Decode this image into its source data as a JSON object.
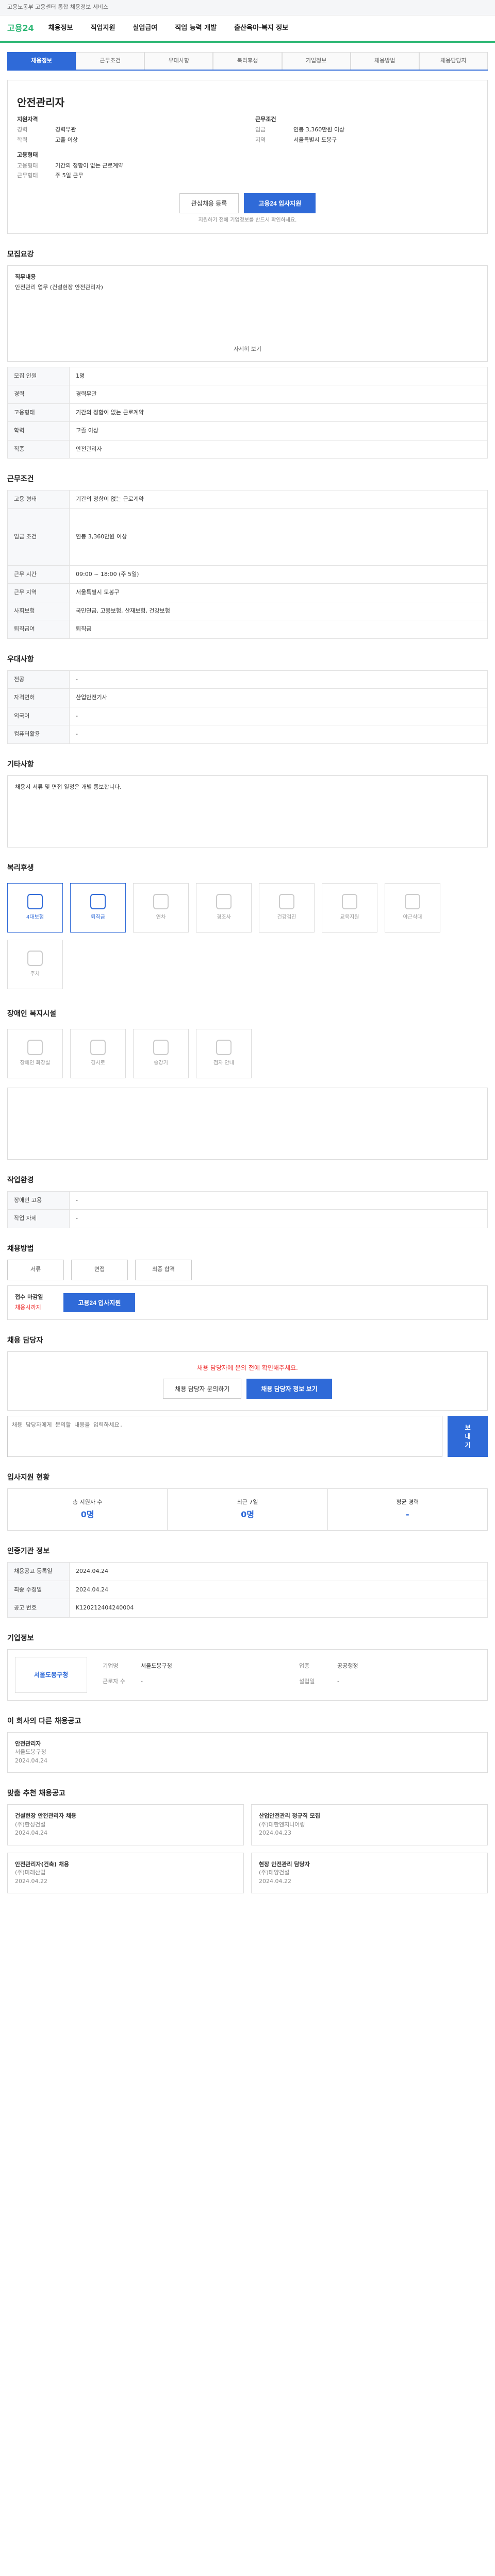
{
  "topbar": {
    "text": "고용노동부 고용센터 통합 채용정보 서비스"
  },
  "gnb": {
    "logo": "고용24",
    "menu": [
      "채용정보",
      "직업지원",
      "실업급여",
      "직업 능력 개발",
      "출산육아·복지 정보"
    ]
  },
  "tabs": [
    "채용정보",
    "근무조건",
    "우대사항",
    "복리후생",
    "기업정보",
    "채용방법",
    "채용담당자"
  ],
  "header": {
    "company": "안전관리자",
    "tag": "채용공고"
  },
  "company_info": {
    "left_title": "지원자격",
    "left_items": [
      {
        "k": "경력",
        "v": "경력무관"
      },
      {
        "k": "학력",
        "v": "고졸 이상"
      }
    ],
    "right_title": "근무조건",
    "right_items": [
      {
        "k": "임금",
        "v": "연봉 3,360만원 이상"
      },
      {
        "k": "지역",
        "v": "서울특별시 도봉구"
      }
    ],
    "job_title": "고용형태",
    "job_items": [
      {
        "k": "고용형태",
        "v": "기간의 정함이 없는 근로계약"
      },
      {
        "k": "근무형태",
        "v": "주 5일 근무"
      }
    ],
    "cta_primary": "고용24 입사지원",
    "cta_secondary": "관심채용 등록",
    "notice": "지원하기 전에 기업정보를 반드시 확인하세요."
  },
  "job": {
    "title": "모집요강",
    "duty_label": "직무내용",
    "duty": "안전관리 업무 (건설현장 안전관리자)",
    "list_label": "자세히 보기"
  },
  "job_table": [
    {
      "k": "모집 인원",
      "v": "1명"
    },
    {
      "k": "경력",
      "v": "경력무관"
    },
    {
      "k": "고용형태",
      "v": "기간의 정함이 없는 근로계약"
    },
    {
      "k": "학력",
      "v": "고졸 이상"
    },
    {
      "k": "직종",
      "v": "안전관리자"
    }
  ],
  "work": {
    "title": "근무조건"
  },
  "work_table": [
    {
      "k": "고용 형태",
      "v": "기간의 정함이 없는 근로계약"
    },
    {
      "k": "임금 조건",
      "v": "연봉 3,360만원 이상"
    },
    {
      "k": "근무 시간",
      "v": "09:00 ~ 18:00 (주 5일)"
    },
    {
      "k": "근무 지역",
      "v": "서울특별시 도봉구"
    },
    {
      "k": "사회보험",
      "v": "국민연금, 고용보험, 산재보험, 건강보험"
    },
    {
      "k": "퇴직급여",
      "v": "퇴직금"
    }
  ],
  "pref": {
    "title": "우대사항"
  },
  "pref_table": [
    {
      "k": "전공",
      "v": "-"
    },
    {
      "k": "자격면허",
      "v": "산업안전기사"
    },
    {
      "k": "외국어",
      "v": "-"
    },
    {
      "k": "컴퓨터활용",
      "v": "-"
    }
  ],
  "extra": {
    "title": "기타사항",
    "text": "채용시 서류 및 면접 일정은 개별 통보합니다."
  },
  "welfare": {
    "title": "복리후생",
    "items": [
      "4대보험",
      "퇴직금",
      "연차",
      "경조사",
      "건강검진",
      "교육지원",
      "야근식대",
      "주차"
    ]
  },
  "disability": {
    "title": "장애인 복지시설",
    "items": [
      "장애인 화장실",
      "경사로",
      "승강기",
      "점자 안내"
    ]
  },
  "workplace": {
    "title": "작업환경",
    "rows": [
      {
        "k": "장애인 고용",
        "v": "-"
      },
      {
        "k": "작업 자세",
        "v": "-"
      }
    ]
  },
  "method": {
    "title": "채용방법",
    "steps": [
      "서류",
      "면접",
      "최종 합격"
    ],
    "apply_label": "접수 마감일",
    "apply_value": "채용시까지",
    "cta": "고용24 입사지원"
  },
  "contact": {
    "title": "채용 담당자",
    "banner": "채용 담당자에 문의 전에 확인해주세요.",
    "btn1": "채용 담당자 문의하기",
    "btn2": "채용 담당자 정보 보기",
    "ta_placeholder": "채용 담당자에게 문의할 내용을 입력하세요.",
    "send": "보내기"
  },
  "stats": {
    "title": "입사지원 현황",
    "items": [
      {
        "label": "총 지원자 수",
        "value": "0명"
      },
      {
        "label": "최근 7일",
        "value": "0명"
      },
      {
        "label": "평균 경력",
        "value": "-"
      }
    ]
  },
  "info": {
    "title": "인증기관 정보"
  },
  "info_table": [
    {
      "k": "채용공고 등록일",
      "v": "2024.04.24"
    },
    {
      "k": "최종 수정일",
      "v": "2024.04.24"
    },
    {
      "k": "공고 번호",
      "v": "K120212404240004"
    }
  ],
  "company_sec": {
    "title": "기업정보",
    "name": "서울도봉구청",
    "items": [
      {
        "k": "기업명",
        "v": "서울도봉구청"
      },
      {
        "k": "업종",
        "v": "공공행정"
      },
      {
        "k": "근로자 수",
        "v": "-"
      },
      {
        "k": "설립일",
        "v": "-"
      }
    ]
  },
  "related": {
    "title": "이 회사의 다른 채용공고",
    "items": [
      {
        "title": "안전관리자",
        "org": "서울도봉구청",
        "date": "2024.04.24"
      }
    ]
  },
  "recommend": {
    "title": "맞춤 추천 채용공고",
    "items": [
      {
        "title": "건설현장 안전관리자 채용",
        "org": "(주)한성건설",
        "date": "2024.04.24"
      },
      {
        "title": "산업안전관리 정규직 모집",
        "org": "(주)대한엔지니어링",
        "date": "2024.04.23"
      },
      {
        "title": "안전관리자(건축) 채용",
        "org": "(주)미래산업",
        "date": "2024.04.22"
      },
      {
        "title": "현장 안전관리 담당자",
        "org": "(주)태양건설",
        "date": "2024.04.22"
      }
    ]
  }
}
